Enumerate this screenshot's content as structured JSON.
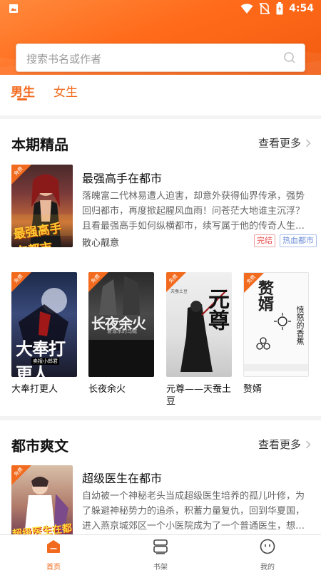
{
  "status_bar": {
    "time": "4:54"
  },
  "search": {
    "placeholder": "搜索书名或作者"
  },
  "gender_tabs": [
    {
      "label": "男生",
      "active": true
    },
    {
      "label": "女生",
      "active": false
    }
  ],
  "section_featured": {
    "title": "本期精品",
    "see_more": "查看更多",
    "featured_book": {
      "title": "最强高手在都市",
      "description": "落魄富二代林易遭人迫害，却意外获得仙界传承，强势回归都市，再度掀起腥风血雨！问苍茫大地谁主沉浮？且看最强高手如何纵横都市，续写属于他的传奇人生。本文依旧延续...",
      "author": "散心靓意",
      "tags": [
        "完结",
        "热血都市"
      ],
      "cover_text": "最强高手在都市",
      "free": true
    },
    "grid_books": [
      {
        "title": "大奉打更人",
        "cover_text": "大奉打更人",
        "cover_sub": "卖报小郎君",
        "free": true
      },
      {
        "title": "长夜余火",
        "cover_text": "长夜余火",
        "cover_sub": "爱潜水的乌贼",
        "free": true
      },
      {
        "title": "元尊——天蚕土豆",
        "cover_text": "元尊",
        "cover_sub": "天蚕土豆",
        "free": true
      },
      {
        "title": "赘婿",
        "cover_text": "赘婿",
        "cover_sub": "愤怒的香蕉",
        "free": true
      }
    ]
  },
  "section_urban": {
    "title": "都市爽文",
    "see_more": "查看更多",
    "featured_book": {
      "title": "超级医生在都市",
      "description": "自幼被一个神秘老头当成超级医生培养的孤儿叶修，为了躲避神秘势力的追杀，积蓄力量复仇，回到华夏国，进入燕京城郊区一个小医院成为了一个普通医生，想要低调平静地过...",
      "cover_text": "超级医生在都市",
      "free": true
    }
  },
  "bottom_nav": [
    {
      "label": "首页",
      "icon": "home-icon",
      "active": true
    },
    {
      "label": "书架",
      "icon": "bookshelf-icon",
      "active": false
    },
    {
      "label": "我的",
      "icon": "profile-icon",
      "active": false
    }
  ],
  "free_badge_text": "免费",
  "colors": {
    "accent": "#f26a1d",
    "tag_done": "#e84d4d",
    "tag_genre": "#6b8cd6"
  }
}
